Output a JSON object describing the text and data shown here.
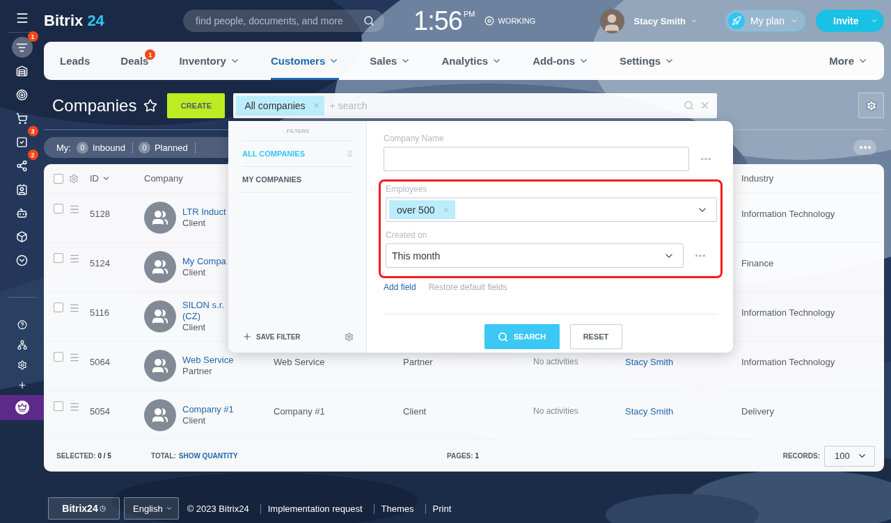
{
  "header": {
    "logo": {
      "name": "Bitrix",
      "suffix": "24"
    },
    "search": {
      "placeholder": "find people, documents, and more"
    },
    "clock": {
      "time": "1:56",
      "period": "PM"
    },
    "work_status": "WORKING",
    "user": {
      "name": "Stacy Smith"
    },
    "plan_button": "My plan",
    "invite_button": "Invite"
  },
  "sidebar": {
    "items": [
      {
        "selected": true,
        "badge": "1"
      },
      {
        "selected": false
      },
      {
        "selected": false
      },
      {
        "selected": false
      },
      {
        "selected": false,
        "badge": "3"
      },
      {
        "selected": false,
        "badge": "2"
      },
      {
        "selected": false
      },
      {
        "selected": false
      },
      {
        "selected": false
      },
      {
        "selected": false
      }
    ],
    "tools": [
      {
        "kind": "tool"
      },
      {
        "kind": "tool"
      },
      {
        "kind": "tool"
      },
      {
        "kind": "tool"
      },
      {
        "kind": "upgrade"
      }
    ]
  },
  "nav": {
    "items": [
      {
        "label": "Leads",
        "selected": false,
        "dropdown": false
      },
      {
        "label": "Deals",
        "selected": false,
        "dropdown": false,
        "badge": "1"
      },
      {
        "label": "Inventory",
        "selected": false,
        "dropdown": true
      },
      {
        "label": "Customers",
        "selected": true,
        "dropdown": true
      },
      {
        "label": "Sales",
        "selected": false,
        "dropdown": true
      },
      {
        "label": "Analytics",
        "selected": false,
        "dropdown": true
      },
      {
        "label": "Add-ons",
        "selected": false,
        "dropdown": true
      },
      {
        "label": "Settings",
        "selected": false,
        "dropdown": true
      }
    ],
    "more": "More"
  },
  "page": {
    "title": "Companies",
    "favorite": false,
    "create_button": "CREATE"
  },
  "filter_bar": {
    "preset_tag": "All companies",
    "placeholder": "+ search"
  },
  "counters": {
    "label": "My:",
    "items": [
      {
        "count": "0",
        "label": "Inbound"
      },
      {
        "count": "0",
        "label": "Planned"
      }
    ]
  },
  "table": {
    "all_checked": false,
    "columns": {
      "id": "ID",
      "company": "Company",
      "industry": "Industry"
    },
    "rows": [
      {
        "checked": false,
        "id": "5128",
        "name": "LTR Induct",
        "name_cont": "",
        "type": "Client",
        "industry": "Information Technology"
      },
      {
        "checked": false,
        "id": "5124",
        "name": "My Compa",
        "type": "Client",
        "industry": "Finance"
      },
      {
        "checked": false,
        "id": "5116",
        "name": "SILON s.r.",
        "name_cont": "(CZ)",
        "type": "Client",
        "industry": "Information Technology"
      },
      {
        "checked": false,
        "id": "5064",
        "name": "Web Service",
        "type": "Partner",
        "column_3": "Web Service",
        "column_4": "Partner",
        "column_5": "No activities",
        "column_6": "Stacy Smith",
        "industry": "Information Technology"
      },
      {
        "checked": false,
        "id": "5054",
        "name": "Company #1",
        "type": "Client",
        "column_3": "Company #1",
        "column_4": "Client",
        "column_5": "No activities",
        "column_6": "Stacy Smith",
        "industry": "Delivery"
      }
    ],
    "footer": {
      "selected_label": "SELECTED:",
      "selected_value": "0 / 5",
      "total_label": "TOTAL:",
      "total_link": "SHOW QUANTITY",
      "pages_label": "PAGES:",
      "pages_value": "1",
      "records_label": "RECORDS:",
      "records_value": "100"
    }
  },
  "filter_popup": {
    "heading": "FILTERS",
    "presets": [
      {
        "label": "ALL COMPANIES",
        "selected": true,
        "pinned": true
      },
      {
        "label": "MY COMPANIES",
        "selected": false,
        "pinned": false
      }
    ],
    "save_filter": "SAVE FILTER",
    "fields": [
      {
        "kind": "text",
        "label": "Company Name",
        "menu": true,
        "highlighted": false
      },
      {
        "kind": "multiselect",
        "label": "Employees",
        "tags": [
          "over 500"
        ],
        "menu": false,
        "highlighted": true
      },
      {
        "kind": "select",
        "label": "Created on",
        "value": "This month",
        "menu": true,
        "highlighted": true
      }
    ],
    "add_field": "Add field",
    "restore": "Restore default fields",
    "search_button": "SEARCH",
    "reset_button": "RESET"
  },
  "page_footer": {
    "logo": "Bitrix24",
    "language": "English",
    "copyright": "© 2023 Bitrix24",
    "links": [
      "Implementation request",
      "Themes",
      "Print"
    ]
  }
}
